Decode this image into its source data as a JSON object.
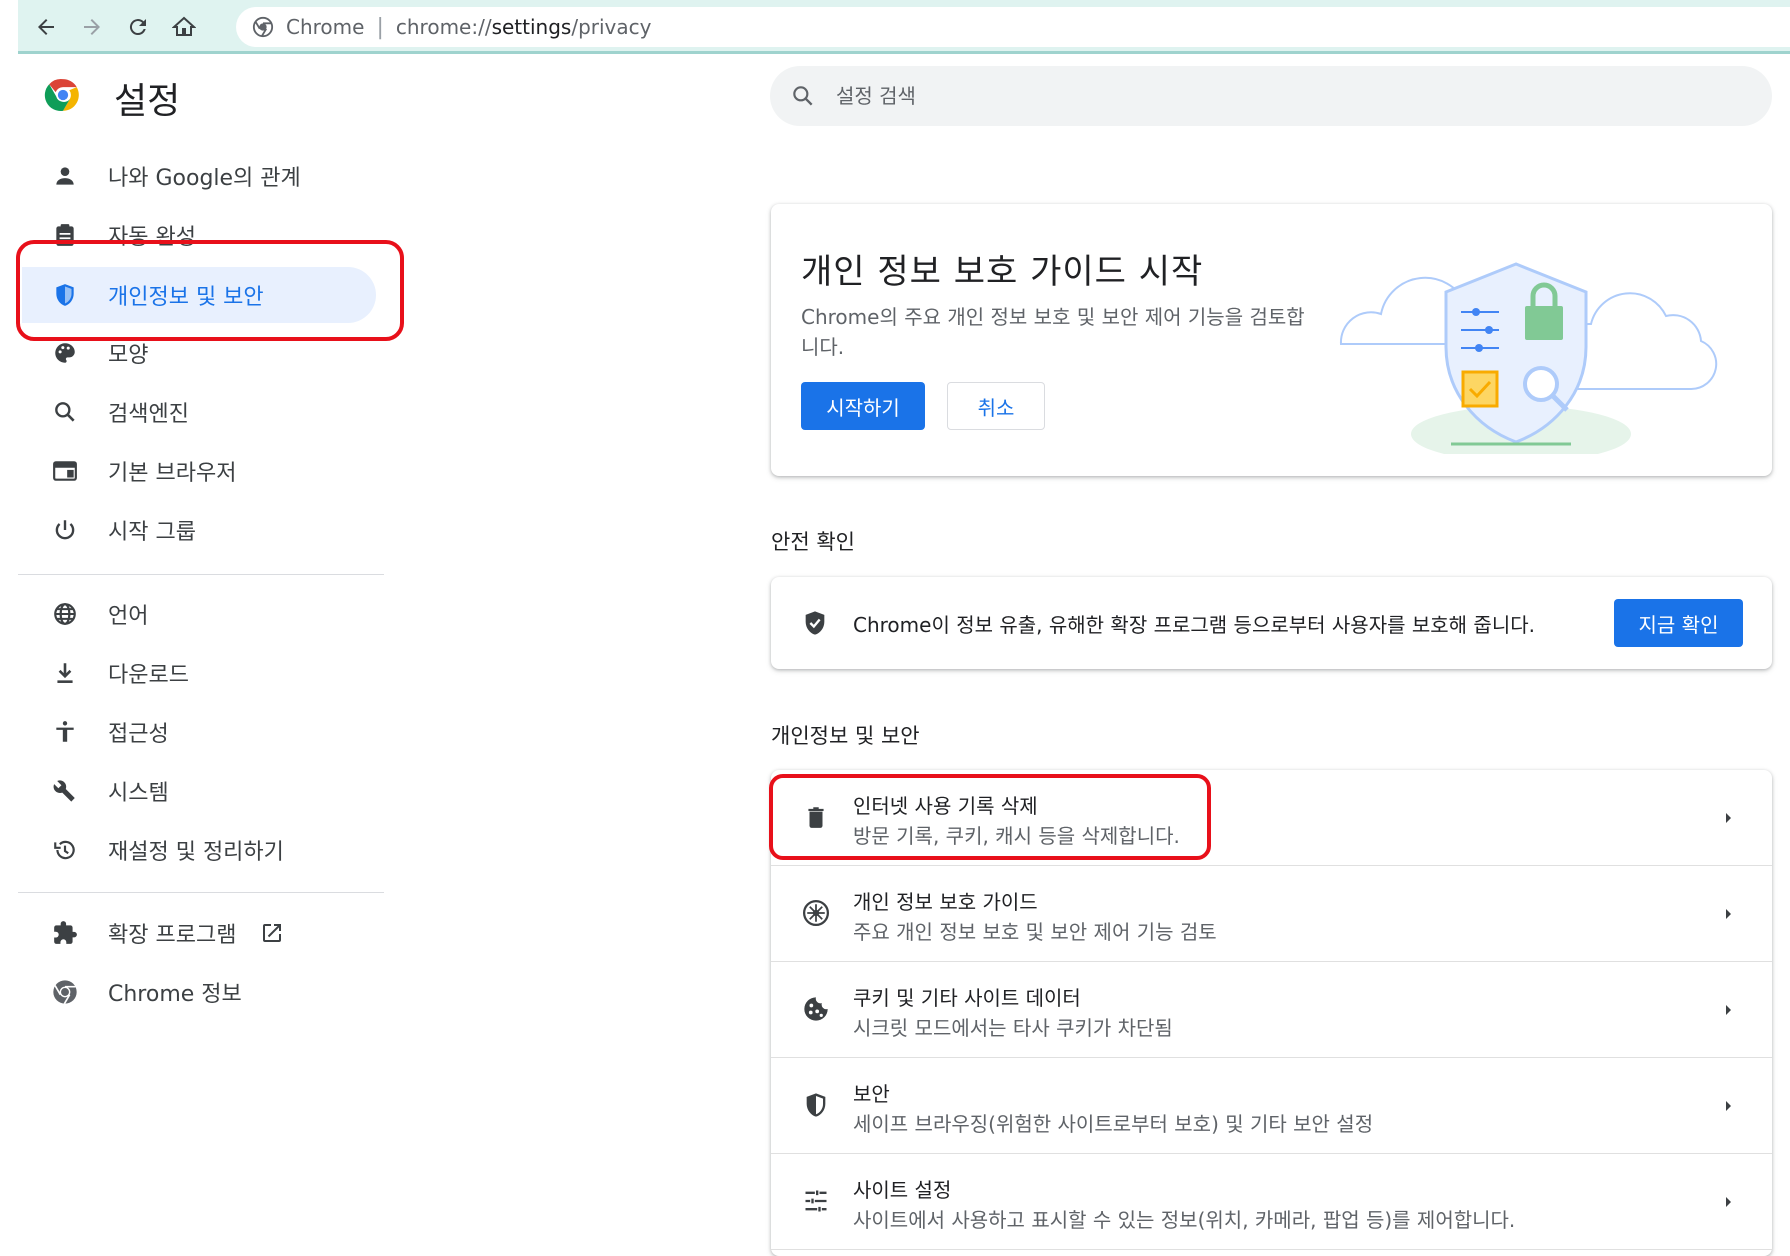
{
  "browser": {
    "site_label": "Chrome",
    "url_prefix": "chrome://",
    "url_main": "settings",
    "url_path": "/privacy"
  },
  "settings": {
    "title": "설정",
    "search_placeholder": "설정 검색"
  },
  "sidebar": {
    "items": [
      {
        "label": "나와 Google의 관계",
        "icon": "person-icon"
      },
      {
        "label": "자동 완성",
        "icon": "clipboard-icon"
      },
      {
        "label": "개인정보 및 보안",
        "icon": "shield-icon",
        "active": true
      },
      {
        "label": "모양",
        "icon": "palette-icon"
      },
      {
        "label": "검색엔진",
        "icon": "search-icon"
      },
      {
        "label": "기본 브라우저",
        "icon": "browser-icon"
      },
      {
        "label": "시작 그룹",
        "icon": "power-icon"
      },
      {
        "label": "언어",
        "icon": "globe-icon"
      },
      {
        "label": "다운로드",
        "icon": "download-icon"
      },
      {
        "label": "접근성",
        "icon": "accessibility-icon"
      },
      {
        "label": "시스템",
        "icon": "wrench-icon"
      },
      {
        "label": "재설정 및 정리하기",
        "icon": "history-icon"
      },
      {
        "label": "확장 프로그램",
        "icon": "puzzle-icon"
      },
      {
        "label": "Chrome 정보",
        "icon": "chrome-icon"
      }
    ]
  },
  "guide": {
    "title": "개인 정보 보호 가이드 시작",
    "description": "Chrome의 주요 개인 정보 보호 및 보안 제어 기능을 검토합니다.",
    "start_button": "시작하기",
    "cancel_button": "취소"
  },
  "safety_check": {
    "heading": "안전 확인",
    "text": "Chrome이 정보 유출, 유해한 확장 프로그램 등으로부터 사용자를 보호해 줍니다.",
    "button": "지금 확인"
  },
  "privacy": {
    "heading": "개인정보 및 보안",
    "rows": [
      {
        "title": "인터넷 사용 기록 삭제",
        "subtitle": "방문 기록, 쿠키, 캐시 등을 삭제합니다.",
        "icon": "trash-icon"
      },
      {
        "title": "개인 정보 보호 가이드",
        "subtitle": "주요 개인 정보 보호 및 보안 제어 기능 검토",
        "icon": "compass-icon"
      },
      {
        "title": "쿠키 및 기타 사이트 데이터",
        "subtitle": "시크릿 모드에서는 타사 쿠키가 차단됨",
        "icon": "cookie-icon"
      },
      {
        "title": "보안",
        "subtitle": "세이프 브라우징(위험한 사이트로부터 보호) 및 기타 보안 설정",
        "icon": "security-shield-icon"
      },
      {
        "title": "사이트 설정",
        "subtitle": "사이트에서 사용하고 표시할 수 있는 정보(위치, 카메라, 팝업 등)를 제어합니다.",
        "icon": "tune-icon"
      }
    ]
  },
  "colors": {
    "accent": "#1a73e8",
    "active_bg": "#e8f0fe",
    "highlight": "#e8101a",
    "toolbar": "#dff3f0"
  }
}
